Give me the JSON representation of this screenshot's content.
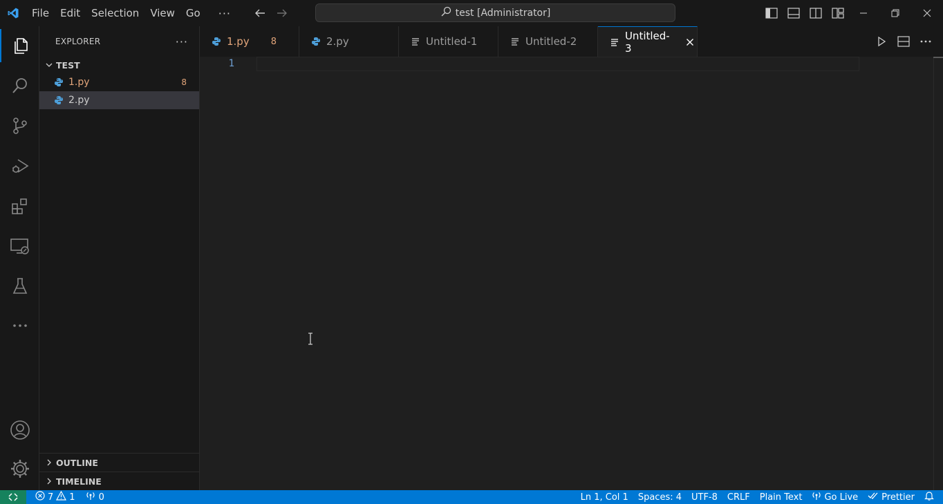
{
  "titlebar": {
    "menu": [
      "File",
      "Edit",
      "Selection",
      "View",
      "Go"
    ],
    "more": "···",
    "command_center": "test [Administrator]"
  },
  "activity_bar": {
    "items": [
      "explorer-icon",
      "search-icon",
      "source-control-icon",
      "run-debug-icon",
      "extensions-icon",
      "remote-explorer-icon",
      "testing-icon",
      "more-icon"
    ],
    "bottom": [
      "account-icon",
      "manage-gear-icon"
    ]
  },
  "sidebar": {
    "title": "EXPLORER",
    "more": "···",
    "folder": "TEST",
    "files": [
      {
        "name": "1.py",
        "badge": "8",
        "error": true
      },
      {
        "name": "2.py",
        "badge": "",
        "error": false
      }
    ],
    "outline": "OUTLINE",
    "timeline": "TIMELINE"
  },
  "tabs": [
    {
      "label": "1.py",
      "badge": "8",
      "type": "python"
    },
    {
      "label": "2.py",
      "badge": "",
      "type": "python"
    },
    {
      "label": "Untitled-1",
      "badge": "",
      "type": "text"
    },
    {
      "label": "Untitled-2",
      "badge": "",
      "type": "text"
    },
    {
      "label": "Untitled-3",
      "badge": "",
      "type": "text",
      "active": true
    }
  ],
  "editor": {
    "line_numbers": [
      "1"
    ]
  },
  "statusbar": {
    "errors": "7",
    "warnings": "1",
    "ports": "0",
    "position": "Ln 1, Col 1",
    "spaces": "Spaces: 4",
    "encoding": "UTF-8",
    "eol": "CRLF",
    "language": "Plain Text",
    "golive": "Go Live",
    "prettier": "Prettier"
  },
  "colors": {
    "accent": "#0078d4",
    "error_orange": "#e2a57a",
    "python_blue": "#4d9ed8",
    "remote_green": "#16825d"
  }
}
